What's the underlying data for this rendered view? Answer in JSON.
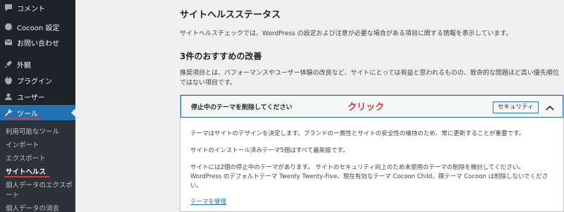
{
  "sidebar": {
    "items": [
      {
        "label": "コメント",
        "icon": "comment-icon"
      },
      {
        "label": "Cocoon 設定",
        "icon": "circle-icon"
      },
      {
        "label": "お問い合わせ",
        "icon": "mail-icon"
      },
      {
        "label": "外観",
        "icon": "brush-icon"
      },
      {
        "label": "プラグイン",
        "icon": "plugin-icon"
      },
      {
        "label": "ユーザー",
        "icon": "user-icon"
      },
      {
        "label": "ツール",
        "icon": "wrench-icon"
      }
    ],
    "submenu": [
      {
        "label": "利用可能なツール"
      },
      {
        "label": "インポート"
      },
      {
        "label": "エクスポート"
      },
      {
        "label": "サイトヘルス"
      },
      {
        "label": "個人データのエクスポ"
      },
      {
        "label": "ート"
      },
      {
        "label": "個人データの消去"
      }
    ]
  },
  "main": {
    "title": "サイトヘルスステータス",
    "description": "サイトヘルスチェックでは、WordPress の設定および注意が必要な場合がある項目に関する情報を表示しています。",
    "section_title": "3件のおすすめの改善",
    "section_description": "推奨項目とは、パフォーマンスやユーザー体験の改良など、サイトにとっては有益と思われるものの、致命的な問題ほど高い優先順位ではない項目です。",
    "accordion": {
      "title": "停止中のテーマを削除してください",
      "annotation": "クリック",
      "badge": "セキュリティ",
      "body": [
        "テーマはサイトのデザインを決定します。ブランドの一貫性とサイトの安全性の維持のため、常に更新することが重要です。",
        "サイトのインストール済みテーマ5個はすべて最新版です。",
        "サイトには2個の停止中のテーマがあります。 サイトのセキュリティ向上のため未使用のテーマの削除を検討してください。WordPress のデフォルトテーマ Twenty Twenty-Five、現在有効なテーマ Cocoon Child、親テーマ Cocoon は削除しないでください。"
      ],
      "link": "テーマを管理"
    }
  },
  "colors": {
    "sidebar_bg": "#1d2327",
    "active_menu": "#2271b1",
    "annotation_red": "#d63638",
    "link": "#2271b1"
  }
}
